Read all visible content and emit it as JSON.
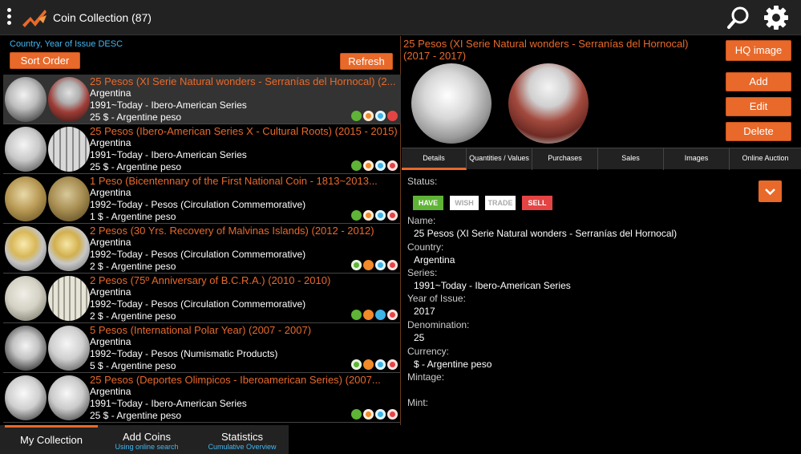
{
  "app": {
    "title": "Coin Collection (87)"
  },
  "left_panel": {
    "sort_caption": "Country, Year of Issue DESC",
    "sort_button": "Sort Order",
    "refresh_button": "Refresh"
  },
  "coins": [
    {
      "title": "25 Pesos (XI Serie Natural wonders - Serranías del Hornocal) (2...",
      "country": "Argentina",
      "series": "1991~Today - Ibero-American Series",
      "value": "25 $ - Argentine peso"
    },
    {
      "title": "25 Pesos (Ibero-American Series X - Cultural Roots) (2015 - 2015)",
      "country": "Argentina",
      "series": "1991~Today - Ibero-American Series",
      "value": "25 $ - Argentine peso"
    },
    {
      "title": "1 Peso (Bicentennary of the First National Coin - 1813~2013...",
      "country": "Argentina",
      "series": "1992~Today - Pesos (Circulation Commemorative)",
      "value": "1 $ - Argentine peso"
    },
    {
      "title": "2 Pesos (30 Yrs. Recovery of Malvinas Islands) (2012 - 2012)",
      "country": "Argentina",
      "series": "1992~Today - Pesos (Circulation Commemorative)",
      "value": "2 $ - Argentine peso"
    },
    {
      "title": "2 Pesos (75º Anniversary of B.C.R.A.) (2010 - 2010)",
      "country": "Argentina",
      "series": "1992~Today - Pesos (Circulation Commemorative)",
      "value": "2 $ - Argentine peso"
    },
    {
      "title": "5 Pesos (International  Polar Year) (2007 - 2007)",
      "country": "Argentina",
      "series": "1992~Today - Pesos (Numismatic Products)",
      "value": "5 $ - Argentine peso"
    },
    {
      "title": "25 Pesos (Deportes Olimpicos - Iberoamerican Series) (2007...",
      "country": "Argentina",
      "series": "1991~Today - Ibero-American Series",
      "value": "25 $ - Argentine peso"
    }
  ],
  "bottom_tabs": [
    {
      "label": "My Collection",
      "sub": ""
    },
    {
      "label": "Add Coins",
      "sub": "Using online search"
    },
    {
      "label": "Statistics",
      "sub": "Cumulative Overview"
    }
  ],
  "detail": {
    "title": "25 Pesos (XI Serie Natural wonders - Serranías del Hornocal) (2017 - 2017)",
    "hq_button": "HQ image",
    "add_button": "Add",
    "edit_button": "Edit",
    "delete_button": "Delete",
    "tabs": [
      "Details",
      "Quantities / Values",
      "Purchases",
      "Sales",
      "Images",
      "Online Auction"
    ],
    "status_label": "Status:",
    "tags": {
      "have": "HAVE",
      "wish": "WISH",
      "trade": "TRADE",
      "sell": "SELL"
    },
    "fields": {
      "name_label": "Name:",
      "name_value": "25 Pesos (XI Serie Natural wonders - Serranías del Hornocal)",
      "country_label": "Country:",
      "country_value": "Argentina",
      "series_label": "Series:",
      "series_value": "1991~Today - Ibero-American Series",
      "year_label": "Year of Issue:",
      "year_value": "2017",
      "denom_label": "Denomination:",
      "denom_value": "25",
      "currency_label": "Currency:",
      "currency_value": "$ - Argentine peso",
      "mintage_label": "Mintage:",
      "mint_label": "Mint:"
    }
  },
  "colors": {
    "accent": "#e8692a",
    "link": "#43b7f0",
    "have": "#5fb336",
    "sell": "#e54444"
  }
}
